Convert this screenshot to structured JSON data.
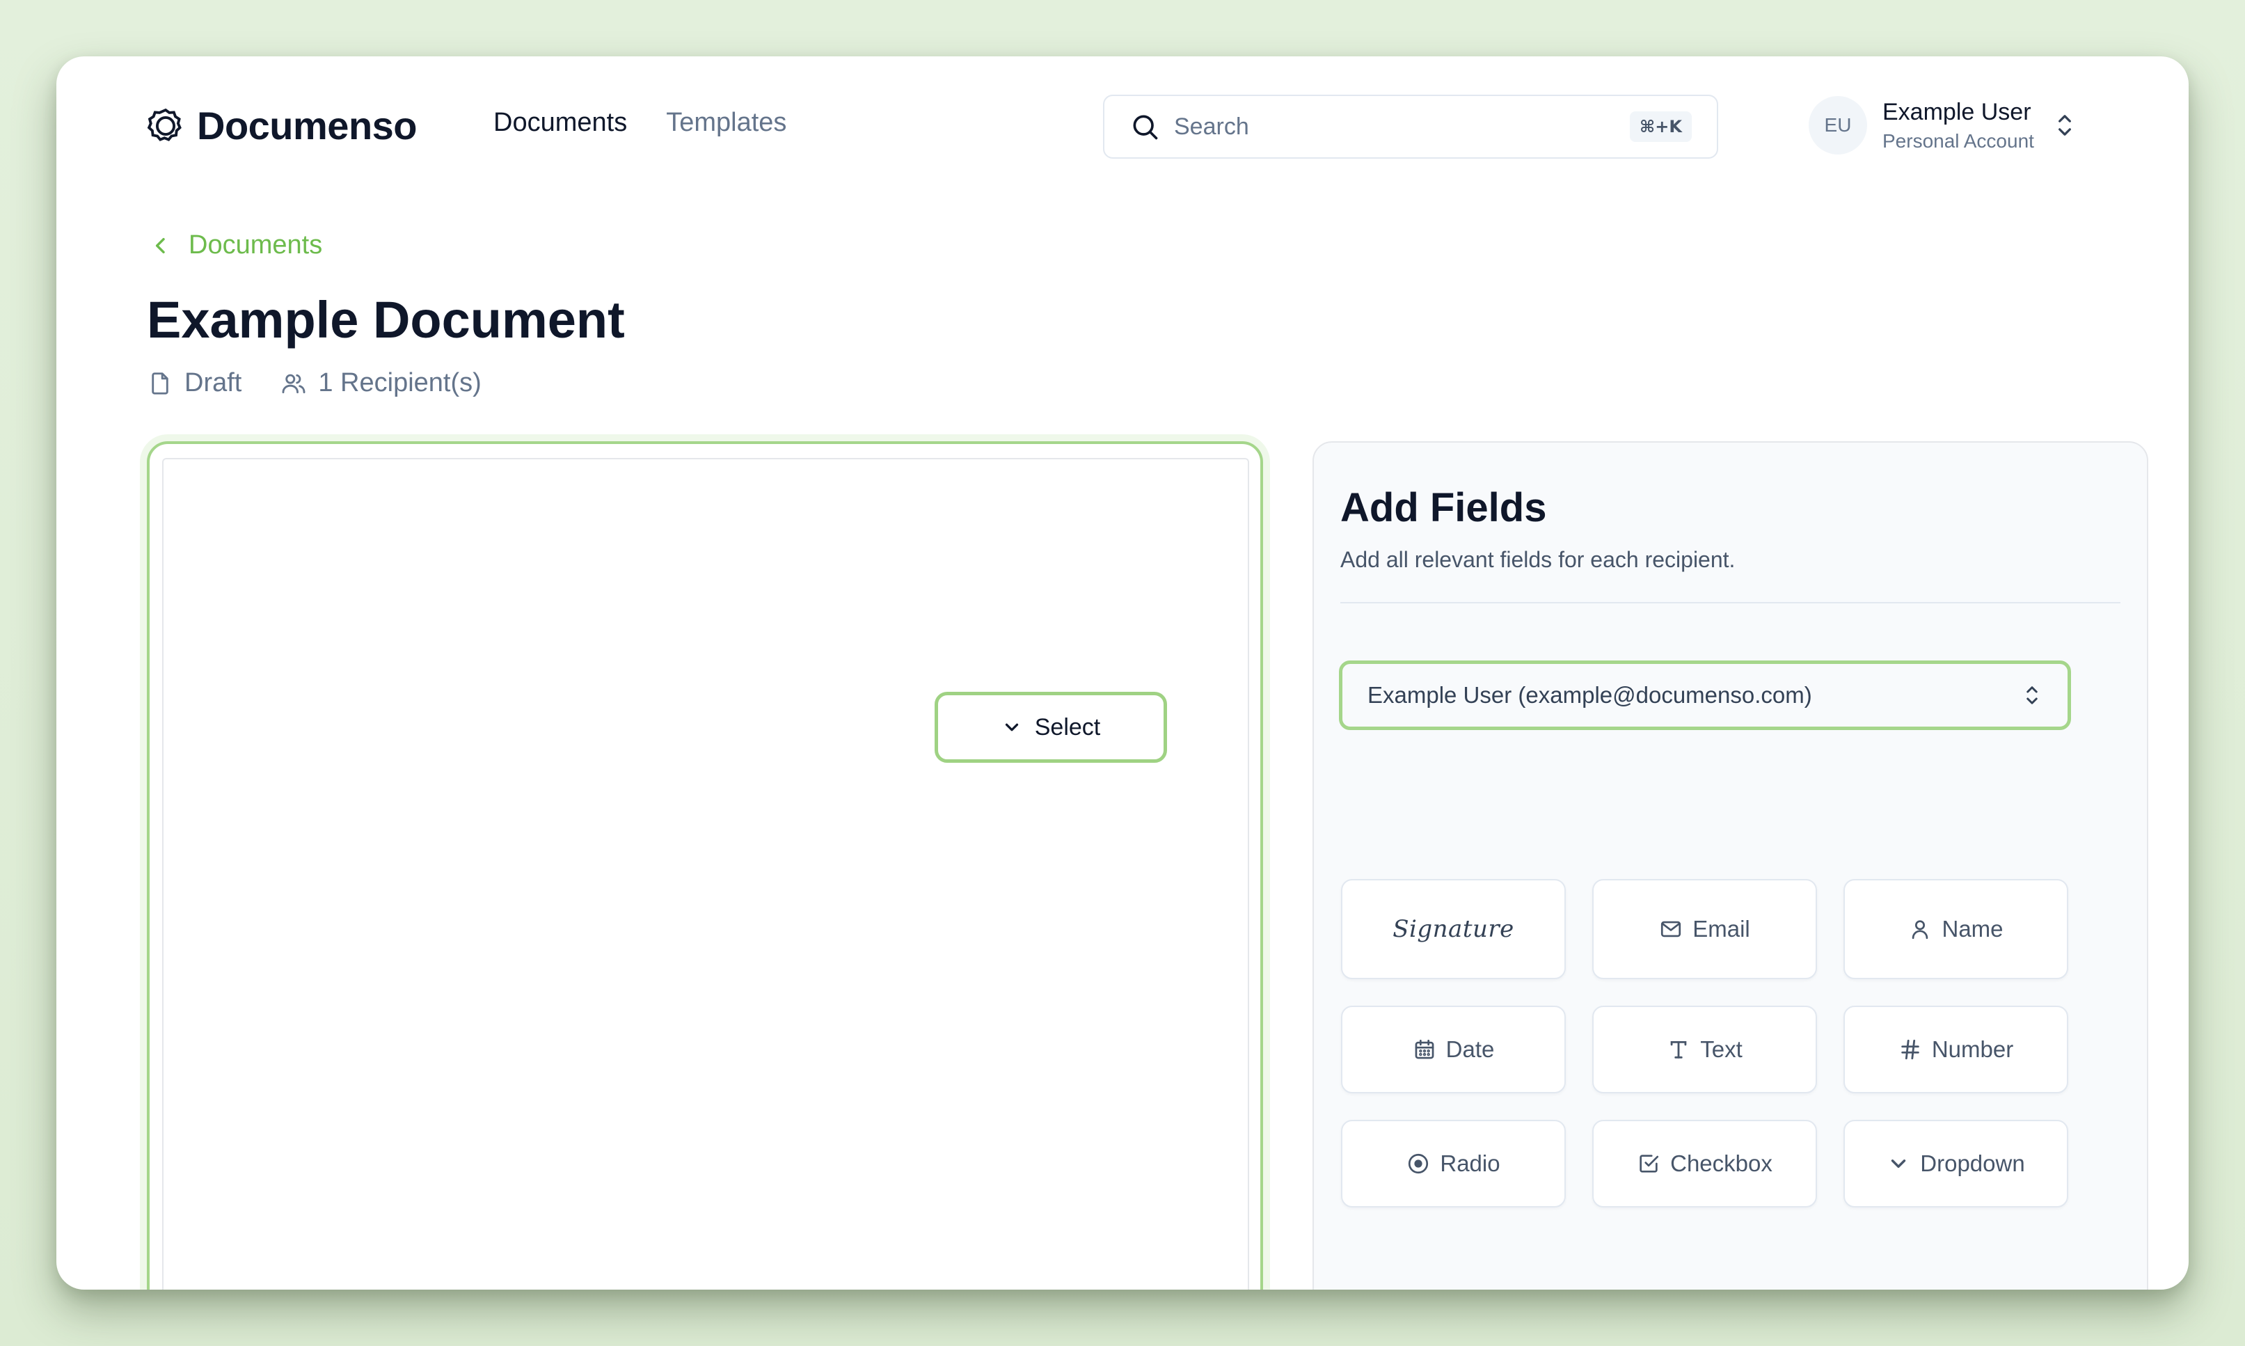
{
  "header": {
    "brand": "Documenso",
    "nav": [
      {
        "label": "Documents",
        "active": true
      },
      {
        "label": "Templates",
        "active": false
      }
    ],
    "search": {
      "placeholder": "Search",
      "shortcut": "⌘+K"
    },
    "user": {
      "initials": "EU",
      "name": "Example User",
      "account": "Personal Account"
    }
  },
  "breadcrumb": {
    "label": "Documents"
  },
  "document": {
    "title": "Example Document",
    "status": "Draft",
    "recipients": "1 Recipient(s)",
    "select_label": "Select"
  },
  "panel": {
    "title": "Add Fields",
    "description": "Add all relevant fields for each recipient.",
    "recipient": "Example User (example@documenso.com)",
    "fields": [
      {
        "label": "Signature",
        "icon": "signature"
      },
      {
        "label": "Email",
        "icon": "mail-icon"
      },
      {
        "label": "Name",
        "icon": "user-icon"
      },
      {
        "label": "Date",
        "icon": "calendar-icon"
      },
      {
        "label": "Text",
        "icon": "text-icon"
      },
      {
        "label": "Number",
        "icon": "hash-icon"
      },
      {
        "label": "Radio",
        "icon": "radio-icon"
      },
      {
        "label": "Checkbox",
        "icon": "checkbox-icon"
      },
      {
        "label": "Dropdown",
        "icon": "chevron-down-icon"
      }
    ]
  },
  "colors": {
    "accent": "#6dbb4c",
    "accent_border": "#a5d68b",
    "text": "#0f172a",
    "muted": "#64748b"
  }
}
